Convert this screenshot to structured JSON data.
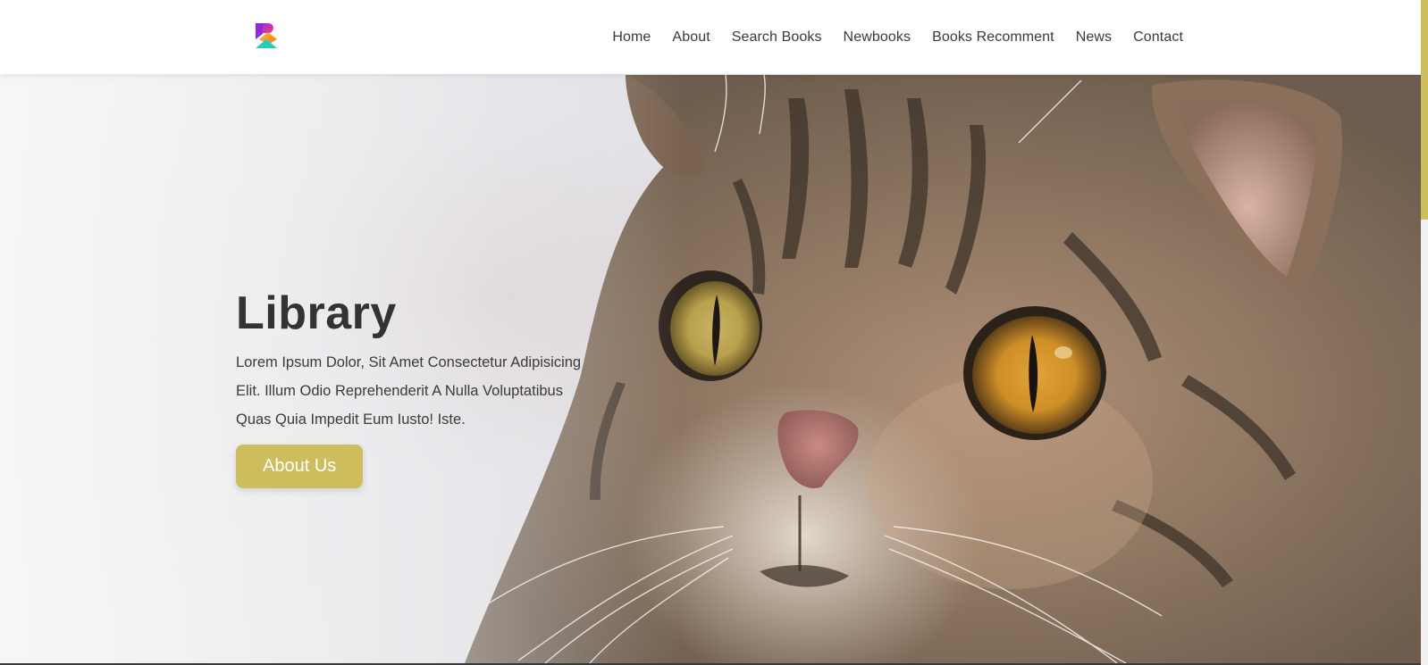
{
  "nav": {
    "items": [
      {
        "label": "Home"
      },
      {
        "label": "About"
      },
      {
        "label": "Search Books"
      },
      {
        "label": "Newbooks"
      },
      {
        "label": "Books Recomment"
      },
      {
        "label": "News"
      },
      {
        "label": "Contact"
      }
    ]
  },
  "hero": {
    "title": "Library",
    "text": "Lorem Ipsum Dolor, Sit Amet Consectetur Adipisicing Elit. Illum Odio Reprehenderit A Nulla Voluptatibus Quas Quia Impedit Eum Iusto! Iste.",
    "button_label": "About Us",
    "background_image": "tabby-cat-photo"
  },
  "colors": {
    "accent": "#cdbd5c",
    "text_dark": "#333333",
    "nav_text": "#3a3a3a",
    "navbar_bg": "#ffffff"
  },
  "icons": {
    "logo": "brand-logo-icon"
  }
}
